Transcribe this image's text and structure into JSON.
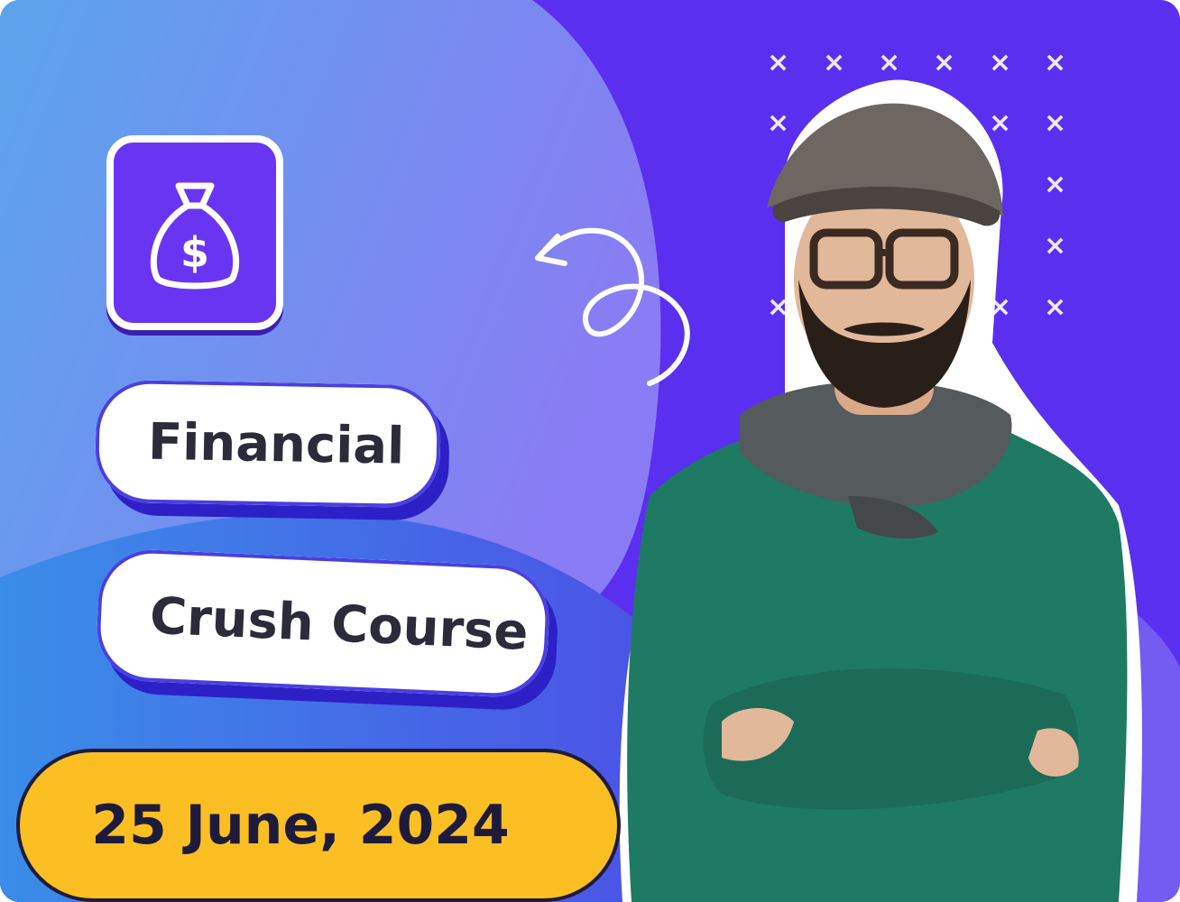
{
  "banner": {
    "tag_line_1": "Financial",
    "tag_line_2": "Crush Course",
    "date": "25 June, 2024",
    "icon": "money-bag-dollar-icon"
  },
  "colors": {
    "background_start": "#5d7df0",
    "background_end": "#5a2df0",
    "icon_tile": "#6a35f2",
    "pill_shadow": "#2d20c6",
    "date_badge": "#fbbf24",
    "text_dark": "#1e1b3a"
  },
  "photo": {
    "subject": "person-portrait",
    "icon": "person-photo"
  }
}
